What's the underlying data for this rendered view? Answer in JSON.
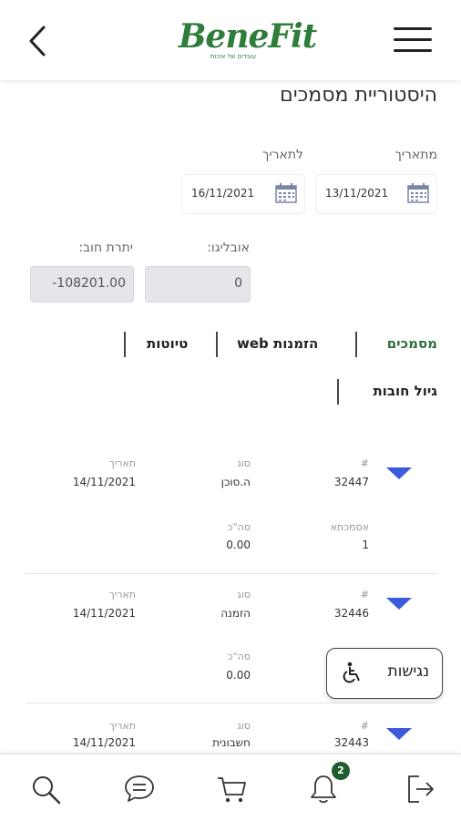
{
  "header": {
    "logo_text": "BeneFit",
    "logo_sub": "עובדים של איכות"
  },
  "page_title": "היסטוריית מסמכים",
  "filters": {
    "from_label": "מתאריך",
    "from_value": "13/11/2021",
    "to_label": "לתאריך",
    "to_value": "16/11/2021"
  },
  "balances": {
    "obligo_label": "אובליגו:",
    "obligo_value": "0",
    "debt_label": "יתרת חוב:",
    "debt_value": "-108201.00"
  },
  "tabs": {
    "documents": "מסמכים",
    "web_orders": "הזמנות web",
    "drafts": "טיוטות",
    "debt_aging": "גיול חובות"
  },
  "rows": [
    {
      "num_label": "#",
      "num": "32447",
      "type_label": "סוג",
      "type": "ה.סוכן",
      "date_label": "תאריך",
      "date": "14/11/2021",
      "asm_label": "אסמכתא",
      "asm": "1",
      "total_label": "סה\"כ",
      "total": "0.00"
    },
    {
      "num_label": "#",
      "num": "32446",
      "type_label": "סוג",
      "type": "הזמנה",
      "date_label": "תאריך",
      "date": "14/11/2021",
      "total_label": "סה\"כ",
      "total": "0.00"
    },
    {
      "num_label": "#",
      "num": "32443",
      "type_label": "סוג",
      "type": "חשבונית",
      "date_label": "תאריך",
      "date": "14/11/2021"
    }
  ],
  "accessibility": {
    "label": "נגישות"
  },
  "nav": {
    "notification_count": "2"
  },
  "colors": {
    "brand_green": "#2e7d3a",
    "accent_blue": "#3b5bdb",
    "badge_green": "#1f5c2e"
  },
  "icons": [
    "back-icon",
    "hamburger-menu-icon",
    "calendar-icon",
    "chevron-down-icon",
    "wheelchair-icon",
    "search-icon",
    "chat-icon",
    "cart-icon",
    "bell-icon",
    "logout-icon"
  ]
}
